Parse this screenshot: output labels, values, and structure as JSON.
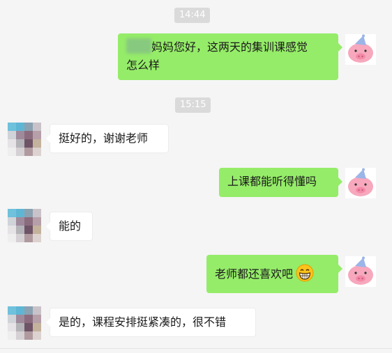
{
  "chat": {
    "timestamps": [
      "14:44",
      "15:15"
    ],
    "messages": [
      {
        "from": "me",
        "text_suffix": "妈妈您好，这两天的集训课感觉",
        "text_line2": "怎么样"
      },
      {
        "from": "them",
        "text": "挺好的，谢谢老师"
      },
      {
        "from": "me",
        "text": "上课都能听得懂吗"
      },
      {
        "from": "them",
        "text": "能的"
      },
      {
        "from": "me",
        "text": "老师都还喜欢吧",
        "emoji": "grinning-face-emoji"
      },
      {
        "from": "them",
        "text": "是的，课程安排挺紧凑的，很不错"
      }
    ]
  },
  "colors": {
    "outgoing_bubble": "#95ec69",
    "incoming_bubble": "#ffffff",
    "background": "#f5f5f5",
    "timestamp_bg": "#dadada"
  },
  "icons": {
    "self_avatar": "pink-pig-avatar-icon",
    "contact_avatar": "pixelated-avatar-icon"
  }
}
